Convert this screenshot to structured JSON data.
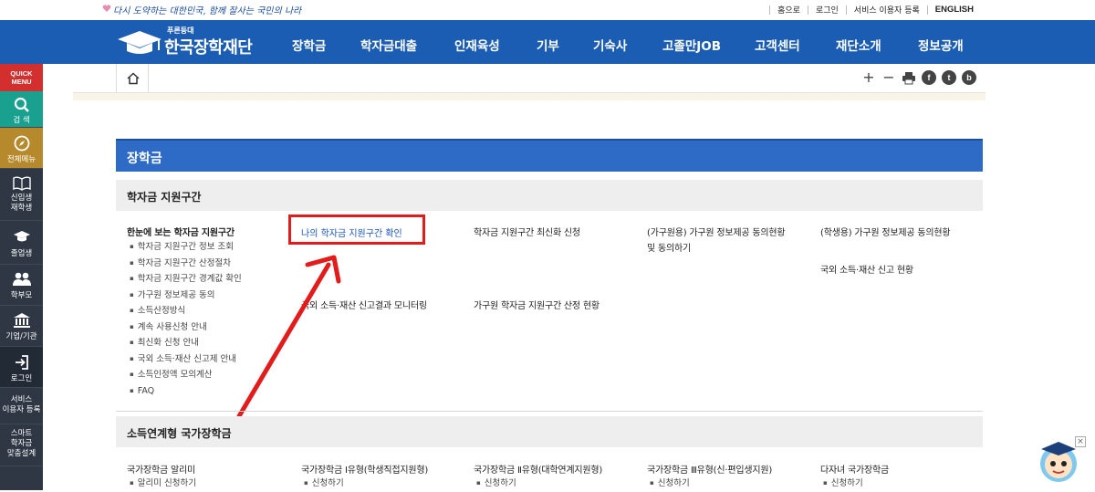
{
  "topbar": {
    "slogan": "다시 도약하는 대한민국, 함께 잘사는 국민의 나라",
    "links": [
      "홈으로",
      "로그인",
      "서비스 이용자 등록",
      "ENGLISH"
    ]
  },
  "nav": {
    "logo_small": "푸른등대",
    "logo_big": "한국장학재단",
    "menu": [
      "장학금",
      "학자금대출",
      "인재육성",
      "기부",
      "기숙사",
      "고졸만JOB",
      "고객센터",
      "재단소개",
      "정보공개"
    ]
  },
  "sidebar": {
    "quick_label_1": "QUICK",
    "quick_label_2": "MENU",
    "items": [
      "검 색",
      "전체메뉴",
      "신입생\n재학생",
      "졸업생",
      "학부모",
      "기업/기관",
      "로그인",
      "서비스\n이용자 등록",
      "스마트\n학자금\n맞춤설계"
    ]
  },
  "subtools": {
    "plus": "+",
    "minus": "−",
    "facebook": "f",
    "twitter": "t",
    "blog": "b"
  },
  "page_title": "장학금",
  "section1": {
    "title": "학자금 지원구간",
    "col1": {
      "title": "한눈에 보는 학자금 지원구간",
      "items": [
        "학자금 지원구간 정보 조회",
        "학자금 지원구간 산정절차",
        "학자금 지원구간 경계값 확인",
        "가구원 정보제공 동의",
        "소득산정방식",
        "계속 사용신청 안내",
        "최신화 신청 안내",
        "국외 소득·재산 신고제 안내",
        "소득인정액 모의계산",
        "FAQ"
      ]
    },
    "col2_a": "나의 학자금 지원구간 확인",
    "col2_b": "국외 소득·재산 신고결과 모니터링",
    "col3_a": "학자금 지원구간 최신화 신청",
    "col3_b": "가구원 학자금 지원구간 산정 현황",
    "col4_a_line1": "(가구원용) 가구원 정보제공 동의현황",
    "col4_a_line2": "및 동의하기",
    "col5_a": "(학생용) 가구원 정보제공 동의현황",
    "col5_b": "국외 소득·재산 신고 현황"
  },
  "section2": {
    "title": "소득연계형 국가장학금",
    "cols": [
      {
        "title": "국가장학금 알리미",
        "item": "알리미 신청하기"
      },
      {
        "title": "국가장학금 Ⅰ유형(학생직접지원형)",
        "item": "신청하기"
      },
      {
        "title": "국가장학금 Ⅱ유형(대학연계지원형)",
        "item": "신청하기"
      },
      {
        "title": "국가장학금 Ⅲ유형(신·편입생지원)",
        "item": "신청하기"
      },
      {
        "title": "다자녀 국가장학금",
        "item": "신청하기"
      }
    ]
  },
  "colors": {
    "nav_blue": "#1c5db4",
    "title_blue": "#2e6bc6",
    "highlight_red": "#e21b1b",
    "sidebar_dark": "#2e3743"
  }
}
